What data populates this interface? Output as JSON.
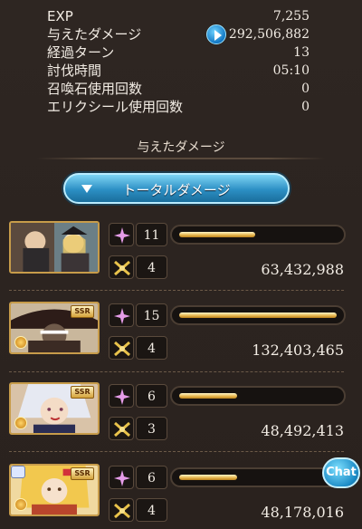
{
  "stats": [
    {
      "label": "EXP",
      "value": "7,255"
    },
    {
      "label": "与えたダメージ",
      "value": "292,506,882"
    },
    {
      "label": "経過ターン",
      "value": "13"
    },
    {
      "label": "討伐時間",
      "value": "05:10"
    },
    {
      "label": "召喚石使用回数",
      "value": "0"
    },
    {
      "label": "エリクシール使用回数",
      "value": "0"
    }
  ],
  "section": {
    "title": "与えたダメージ",
    "dropdown_label": "トータルダメージ"
  },
  "characters": [
    {
      "count_a": "11",
      "count_b": "4",
      "damage": "63,432,988",
      "bar_fraction": 0.48,
      "ssr": false,
      "ssr_label": "",
      "ring": false
    },
    {
      "count_a": "15",
      "count_b": "4",
      "damage": "132,403,465",
      "bar_fraction": 1.0,
      "ssr": true,
      "ssr_label": "SSR",
      "ring": false
    },
    {
      "count_a": "6",
      "count_b": "3",
      "damage": "48,492,413",
      "bar_fraction": 0.37,
      "ssr": true,
      "ssr_label": "SSR",
      "ring": false
    },
    {
      "count_a": "6",
      "count_b": "4",
      "damage": "48,178,016",
      "bar_fraction": 0.37,
      "ssr": true,
      "ssr_label": "SSR",
      "ring": true
    }
  ],
  "chat": {
    "label": "Chat"
  },
  "colors": {
    "panel": "#2b2420",
    "bar_gold": "#e5b34a",
    "accent_blue": "#2c8fc4"
  },
  "icons": {
    "stat_button": "play-icon",
    "count_a": "sparkle-icon",
    "count_b": "crossed-swords-icon",
    "dropdown": "triangle-down-icon"
  }
}
